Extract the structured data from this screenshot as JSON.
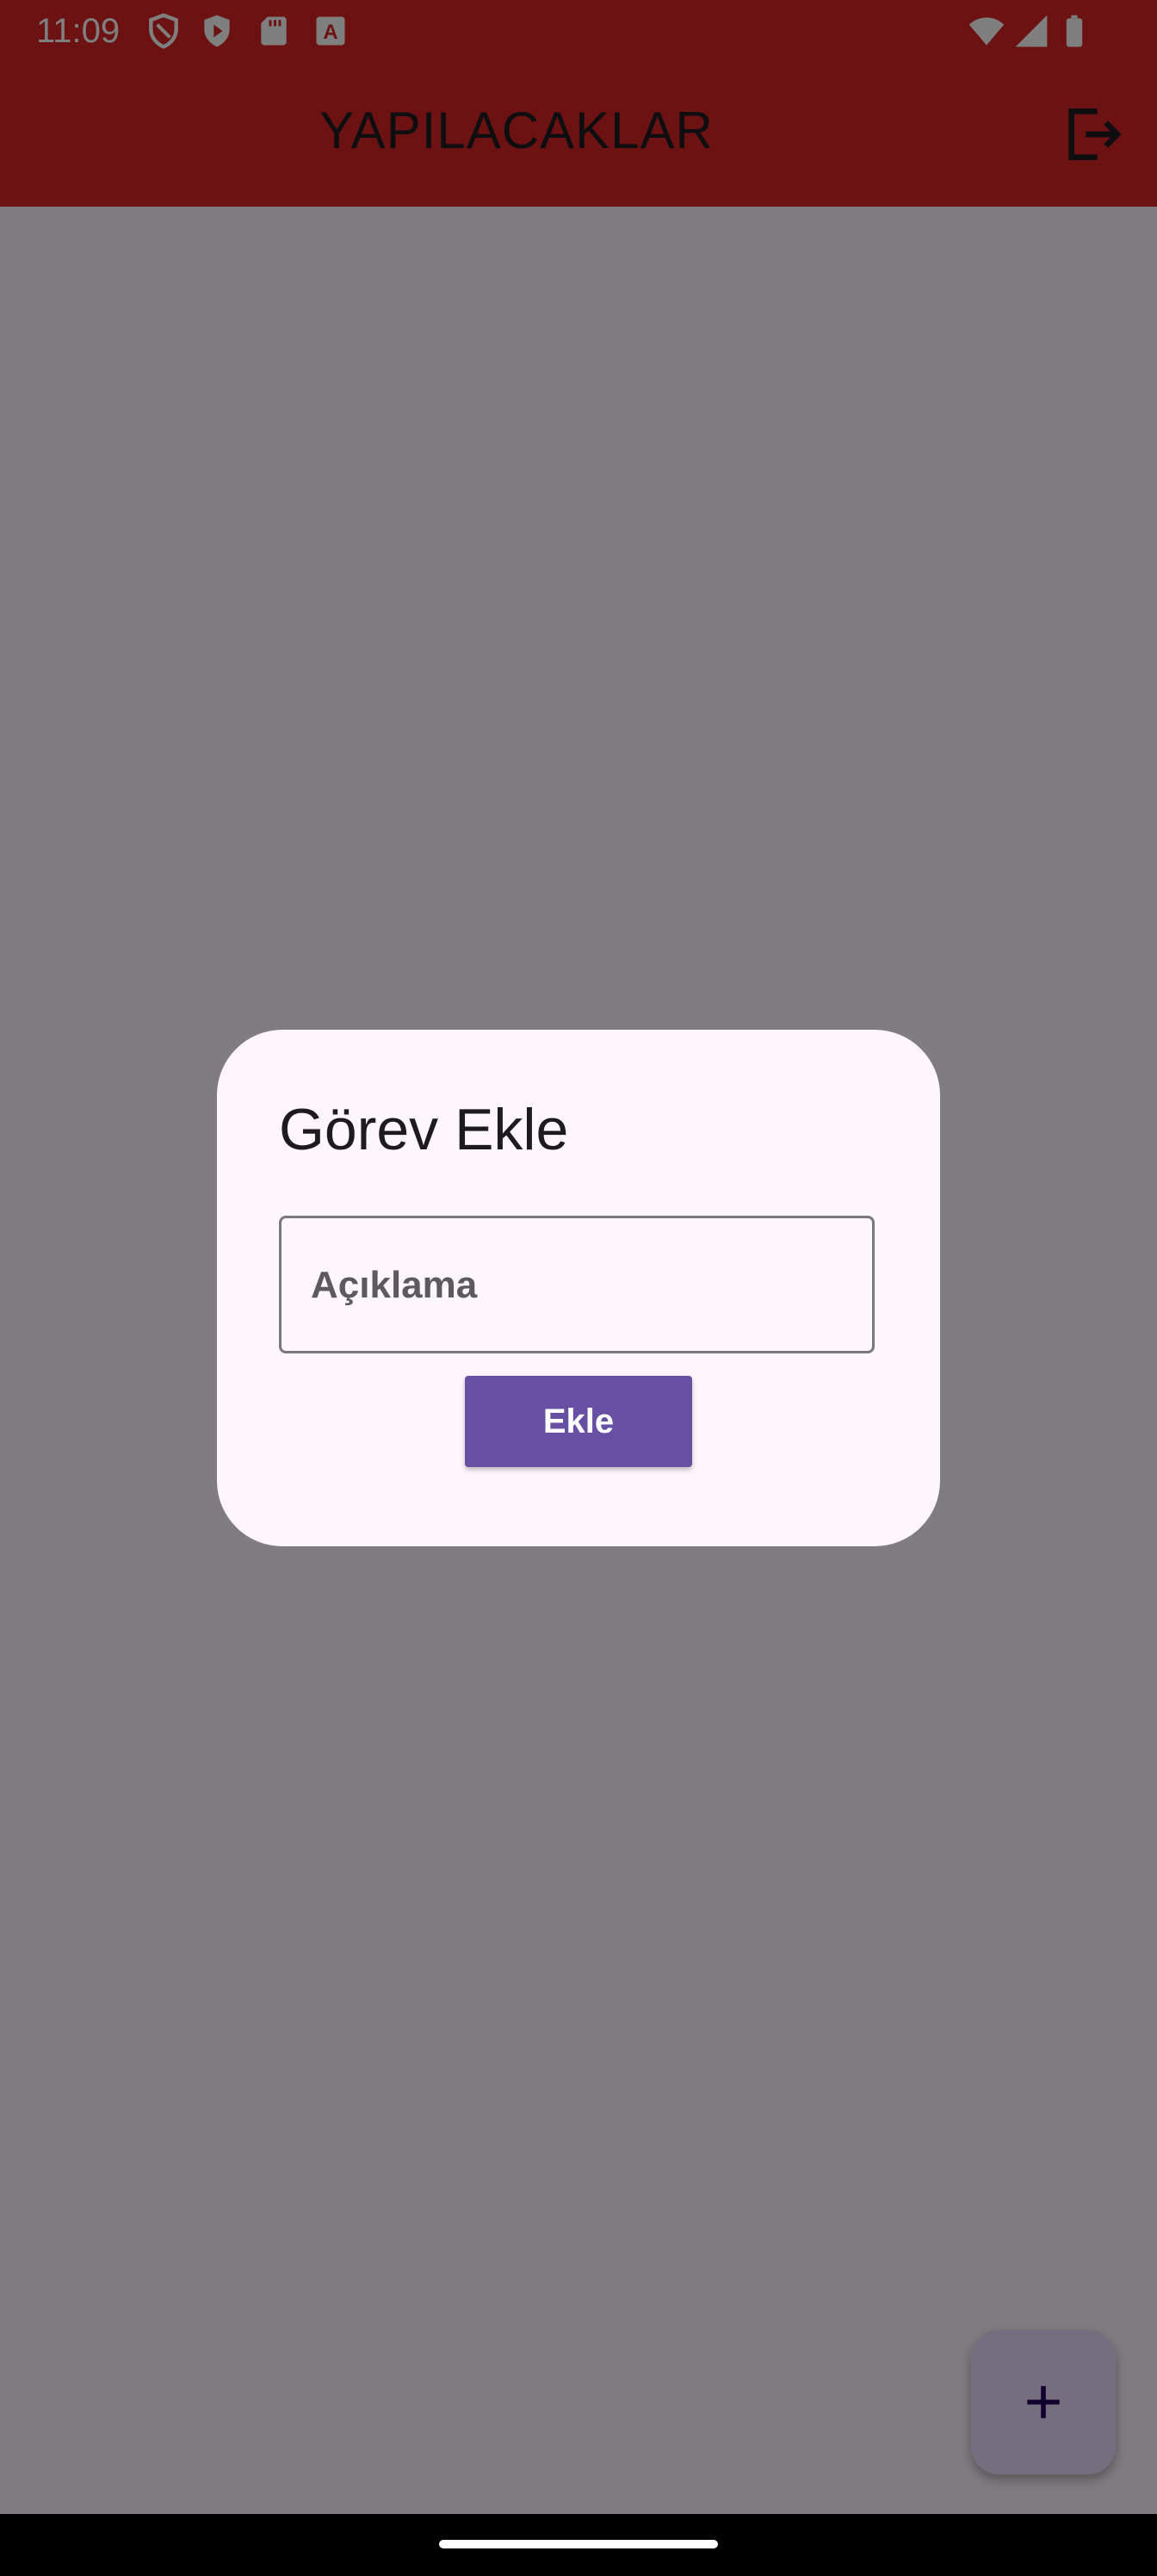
{
  "status_bar": {
    "time": "11:09",
    "icons": [
      "shield-icon",
      "play-protect-icon",
      "sd-card-icon",
      "font-icon",
      "wifi-icon",
      "signal-icon",
      "battery-icon"
    ]
  },
  "app_bar": {
    "title": "YAPILACAKLAR",
    "logout_icon": "logout-icon"
  },
  "dialog": {
    "title": "Görev Ekle",
    "description_placeholder": "Açıklama",
    "add_label": "Ekle"
  },
  "fab": {
    "icon": "plus-icon"
  },
  "colors": {
    "app_bar": "#da2525",
    "primary": "#6750a4",
    "dialog_bg": "#fdf6fb",
    "fab_bg": "#eaddff"
  }
}
